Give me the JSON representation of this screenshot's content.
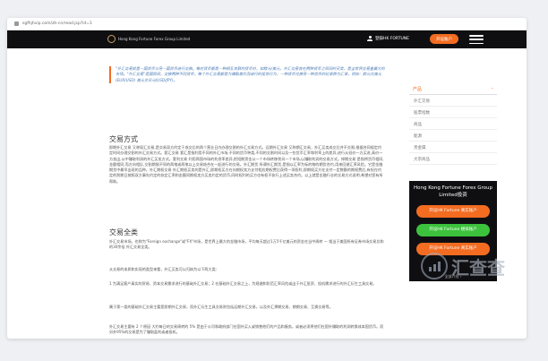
{
  "browser": {
    "url": "sgfhjhvip.com/zh-cn/read.jsp?id=1"
  },
  "nav": {
    "brand_name": "Hong Kong Fortune Forex Group Limited",
    "login_label": "登錄HK FORTUNE",
    "open_account_label": "开设账户"
  },
  "article": {
    "quote": "\"外汇交易就是一国货币与另一国货币进行交换。每对货币都是一种相互关联的货币对，如欧元/美元，外汇交易会在两种货币之间同时买卖，是全世界交易量最大的市场。\"外汇交易\"是国际间，交换两种不同货币，每个外汇交易都是为赚取差价而进行的投资行为，一种货币兑换另一种货币的比率称为汇率，例如：欧元兑美元(EUR/USD) 美元兑日元(USD/JPY)。",
    "section1_heading": "交易方式",
    "section1_para": "即期外汇交易 又称现汇交易,是交易双方约定于成交后的两个营业日内办理交割的外汇交易方式。远期外汇交易 又称期汇交易，外汇买卖成交后并不交割,根据合同规定约定时间办理交割的外汇交易方式。套汇交易 套汇是指利用不同的外汇市场,不同的货币种类,不同的交割时间以及一些货币汇率和利率上的差异,进行从低价一方买进,高价一方卖出,从中赚取利润的外汇买卖方式。套利交易 利用两国市场的利息率差异,把短期资金从一个市场转移到另一个市场,以赚取利润的交易方式。掉期交易 是指将货币相同,金额相同,而方向相反,交割期限不同的两笔或两笔以上交易结合在一起进行的交易。外汇期货 所谓外汇期货,是指以汇率为标的物的期货合约,用来回避汇率风险。它是金融期货中最早出现的品种。外汇期权交易 外汇期权买卖的是外汇,即期权买方在向期权卖方支付相应期权费后获得一项权利,即期权买方在支付一定数额的期权费后,有权在约定的到期日按照双方事先约定的协定汇率和金额同期权卖方买卖约定的货币,同时权利的买方也有权不执行上述买卖合约。以上就是金融行业的交易方式说明,希望对您有所帮助。",
    "section2_heading": "交易全类",
    "section2_para1": "外汇交易市场，也称为\"Foreign exchange\"或\"FX\"市场，是世界上最大的金融市场，平均每天超过1万5千亿美元的资金在当中周转 — 相当于美国所有证券市场交易总和的30余倍 外汇交易全类。",
    "section2_para2": "从交易的本质和实现的类型来看，外汇买卖可以归纳为以下两大类：",
    "section2_para3": "1 为满足客户真实的贸易、资本交易需求进行的基础外汇交易；2 在基础外汇交易之上，为规避和防范汇率风险或出于外汇投资、投机需求进行的外汇衍生工具交易。",
    "section2_para4": "属于第一类的基础外汇交易主要是即期外汇交易，而外汇衍生工具交易则包括远期外汇交易，以及外汇择期交易、期期交易、互换交易等。",
    "section2_para5": "外汇交易主要有 2 个原因 大约每日的交易周转的 5% 是由于公司和政府部门在国外买入或销售他们的产品和服务，或者必须将他们在国外赚取的利润转换成本国货币。而另外95%的交易是为了赚取盈利或者投机。"
  },
  "sidebar": {
    "title": "产品",
    "items": [
      "外汇交易",
      "股票指数",
      "商品",
      "能源",
      "贵金属",
      "大宗商品"
    ]
  },
  "promo": {
    "title": "Hong Kong Fortune Forex Group Limited投资",
    "btn1": "开设HK Fortune 真实账户",
    "btn2": "开设HK Fortune 模拟账户",
    "btn3": "开设HK Fortune 真实账户",
    "more": "全部介绍 ›",
    "colors": {
      "btn1": "#f36c21",
      "btn2": "#3cc23c",
      "btn3": "#f36c21"
    }
  },
  "watermark": {
    "text": "汇查查"
  }
}
